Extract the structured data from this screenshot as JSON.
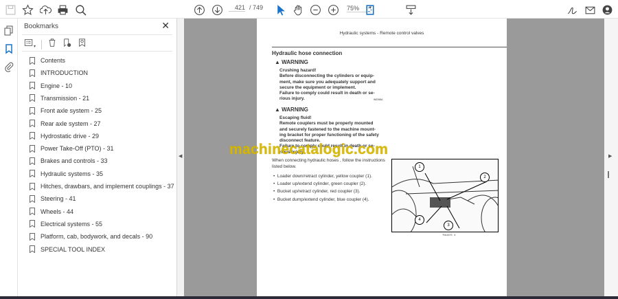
{
  "toolbar": {
    "current_page": "421",
    "total_pages": "/ 749",
    "zoom": "75%",
    "icons": [
      "save-icon",
      "bookmark-star-icon",
      "upload-icon",
      "print-icon",
      "find-icon",
      "prev-page-icon",
      "next-page-icon",
      "select-icon",
      "hand-icon",
      "zoom-out-icon",
      "zoom-in-icon",
      "page-view-icon",
      "scroll-mode-icon",
      "sign-icon",
      "email-icon",
      "account-icon"
    ]
  },
  "panel": {
    "title": "Bookmarks",
    "items": [
      "Contents",
      "INTRODUCTION",
      "Engine - 10",
      "Transmission - 21",
      "Front axle system - 25",
      "Rear axle system - 27",
      "Hydrostatic drive - 29",
      "Power Take-Off (PTO) - 31",
      "Brakes and controls - 33",
      "Hydraulic systems - 35",
      "Hitches, drawbars, and implement couplings - 37",
      "Steering - 41",
      "Wheels - 44",
      "Electrical systems - 55",
      "Platform, cab, bodywork, and decals - 90",
      "SPECIAL TOOL INDEX"
    ]
  },
  "page": {
    "header": "Hydraulic systems - Remote control valves",
    "heading": "Hydraulic hose connection",
    "warning1": {
      "label": "WARNING",
      "lines": [
        "Crushing hazard!",
        "Before disconnecting the cylinders or equip-",
        "ment, make sure you adequately support and",
        "secure the equipment or implement.",
        "Failure to comply could result in death or se-",
        "rious injury."
      ],
      "code": "W0398A"
    },
    "warning2": {
      "label": "WARNING",
      "lines": [
        "Escaping fluid!",
        "Remote couplers must be properly mounted",
        "and securely fastened to the machine mount-",
        "ing bracket for proper functioning of the safety",
        "disconnect feature.",
        "Failure to comply could result in death or se-",
        "rious injury."
      ]
    },
    "intro": [
      "When connecting hydraulic hoses , follow the instructions",
      "listed below."
    ],
    "bullets": [
      "Loader down/retract cylinder, yellow coupler (1).",
      "Loader up/extend cylinder, green coupler (2).",
      "Bucket up/retract cylinder, red coupler (3).",
      "Bucket dump/extend cylinder, blue coupler (4)."
    ],
    "figure": {
      "callouts": [
        "1",
        "2",
        "3",
        "4"
      ],
      "caption": "TN14379",
      "number": "4"
    }
  },
  "watermark": "machinecatalogic.com",
  "colors": {
    "accent": "#1a73c8",
    "watermark": "#d8b800"
  }
}
